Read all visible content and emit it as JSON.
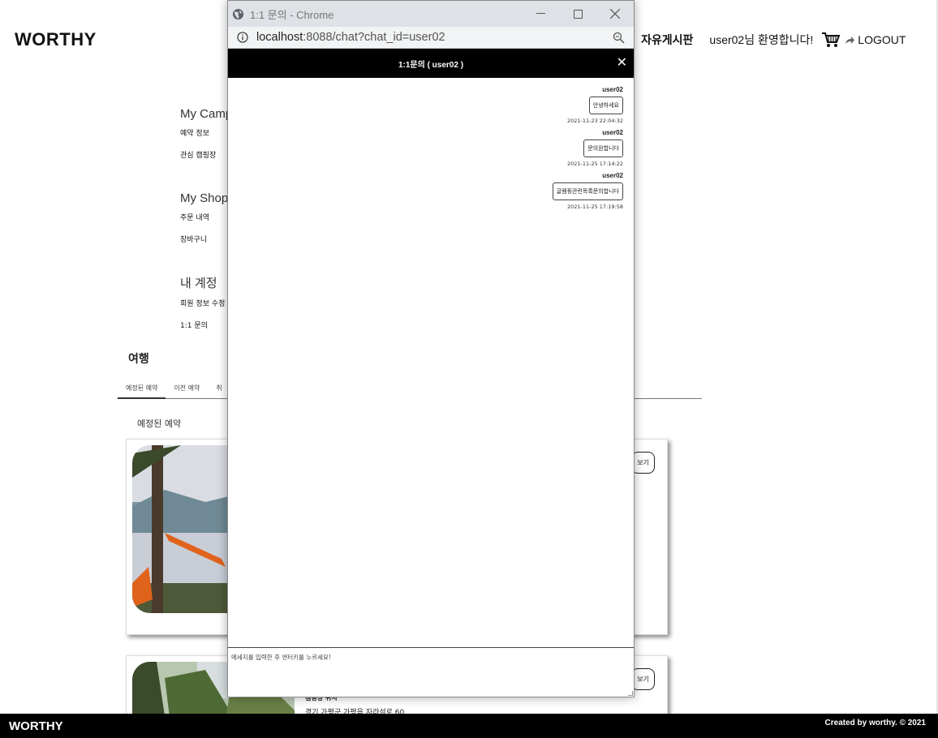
{
  "header": {
    "brand": "WORTHY",
    "board_link": "자유게시판",
    "user": "user02",
    "welcome_suffix": "님 환영합니다!",
    "logout": "LOGOUT"
  },
  "sidebar": {
    "camp": {
      "title": "My Camp",
      "links": [
        "예약 정보",
        "관심 캠핑장"
      ]
    },
    "shop": {
      "title": "My Shop",
      "links": [
        "주문 내역",
        "장바구니"
      ]
    },
    "account": {
      "title": "내 계정",
      "links": [
        "회원 정보 수정",
        "1:1 문의"
      ]
    }
  },
  "trips": {
    "title": "여행",
    "tabs": [
      "예정된 예약",
      "이전 예약",
      "취"
    ],
    "section_label": "예정된 예약",
    "cards": [
      {
        "button": "보기"
      },
      {
        "button": "보기",
        "info_label": "캠핑장 위치",
        "address": "경기 가평군 가평읍 자라섬로 60"
      }
    ]
  },
  "footer": {
    "brand": "WORTHY",
    "copyright": "Created by worthy. © 2021"
  },
  "popup": {
    "window_title": "1:1 문의 - Chrome",
    "url_host": "localhost",
    "url_rest": ":8088/chat?chat_id=user02",
    "chat_title": "1:1문의 ( user02 )",
    "close_symbol": "✕",
    "messages": [
      {
        "sender": "user02",
        "text": "안녕하세요",
        "time": "2021-11-23 22:04:32"
      },
      {
        "sender": "user02",
        "text": "문의원합니다",
        "time": "2021-11-25 17:14:22"
      },
      {
        "sender": "user02",
        "text": "글램핑관련목록문의합니다",
        "time": "2021-11-25 17:19:58"
      }
    ],
    "input_placeholder": "메세지를 입력한 후 엔터키를 누르세요!"
  },
  "colors": {
    "chat_header_bg": "#000000",
    "footer_bg": "#000000",
    "titlebar_bg": "#dee1e6"
  }
}
